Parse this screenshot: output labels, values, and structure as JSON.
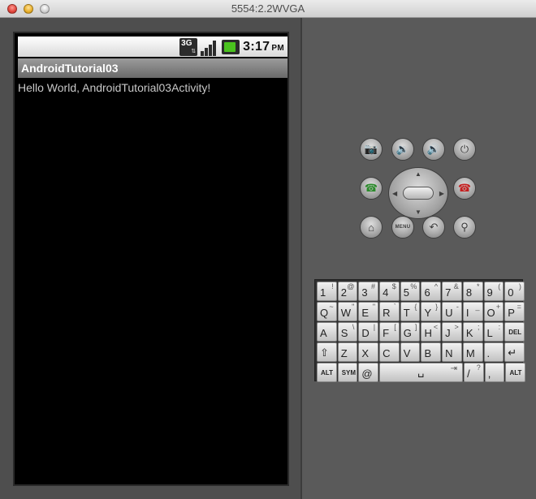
{
  "window": {
    "title": "5554:2.2WVGA"
  },
  "status_bar": {
    "network": "3G",
    "time": "3:17",
    "ampm": "PM"
  },
  "app": {
    "title": "AndroidTutorial03",
    "message": "Hello World, AndroidTutorial03Activity!"
  },
  "controls": {
    "camera": "📷",
    "volume_down": "🔉",
    "volume_up": "🔊",
    "power": "⏻",
    "call": "☎",
    "end_call": "☎",
    "home": "⌂",
    "menu": "MENU",
    "back": "↶",
    "search": "⚲"
  },
  "colors": {
    "call": "#2a8a2a",
    "end_call": "#c42020",
    "battery": "#4ac21e"
  },
  "keyboard": {
    "row1": [
      [
        "1",
        "!"
      ],
      [
        "2",
        "@"
      ],
      [
        "3",
        "#"
      ],
      [
        "4",
        "$"
      ],
      [
        "5",
        "%"
      ],
      [
        "6",
        "^"
      ],
      [
        "7",
        "&"
      ],
      [
        "8",
        "*"
      ],
      [
        "9",
        "("
      ],
      [
        "0",
        ")"
      ]
    ],
    "row2": [
      [
        "Q",
        "~"
      ],
      [
        "W",
        "\""
      ],
      [
        "E",
        "\""
      ],
      [
        "R",
        "`"
      ],
      [
        "T",
        "{"
      ],
      [
        "Y",
        "}"
      ],
      [
        "U",
        "-"
      ],
      [
        "I",
        "_"
      ],
      [
        "O",
        "+"
      ],
      [
        "P",
        "="
      ]
    ],
    "row3": [
      [
        "A",
        ""
      ],
      [
        "S",
        "\\"
      ],
      [
        "D",
        "|"
      ],
      [
        "F",
        "["
      ],
      [
        "G",
        "]"
      ],
      [
        "H",
        "<"
      ],
      [
        "J",
        ">"
      ],
      [
        "K",
        ";"
      ],
      [
        "L",
        ":"
      ],
      [
        "DEL",
        ""
      ]
    ],
    "row4": [
      [
        "⇧",
        ""
      ],
      [
        "Z",
        ""
      ],
      [
        "X",
        ""
      ],
      [
        "C",
        ""
      ],
      [
        "V",
        ""
      ],
      [
        "B",
        ""
      ],
      [
        "N",
        ""
      ],
      [
        "M",
        ""
      ],
      [
        ".",
        ""
      ],
      [
        "↵",
        ""
      ]
    ],
    "row5": [
      [
        "ALT",
        ""
      ],
      [
        "SYM",
        ""
      ],
      [
        "@",
        ""
      ],
      [
        "␣",
        "⇥"
      ],
      [
        "/",
        "?"
      ],
      [
        ",",
        ""
      ],
      [
        "ALT",
        ""
      ]
    ]
  }
}
